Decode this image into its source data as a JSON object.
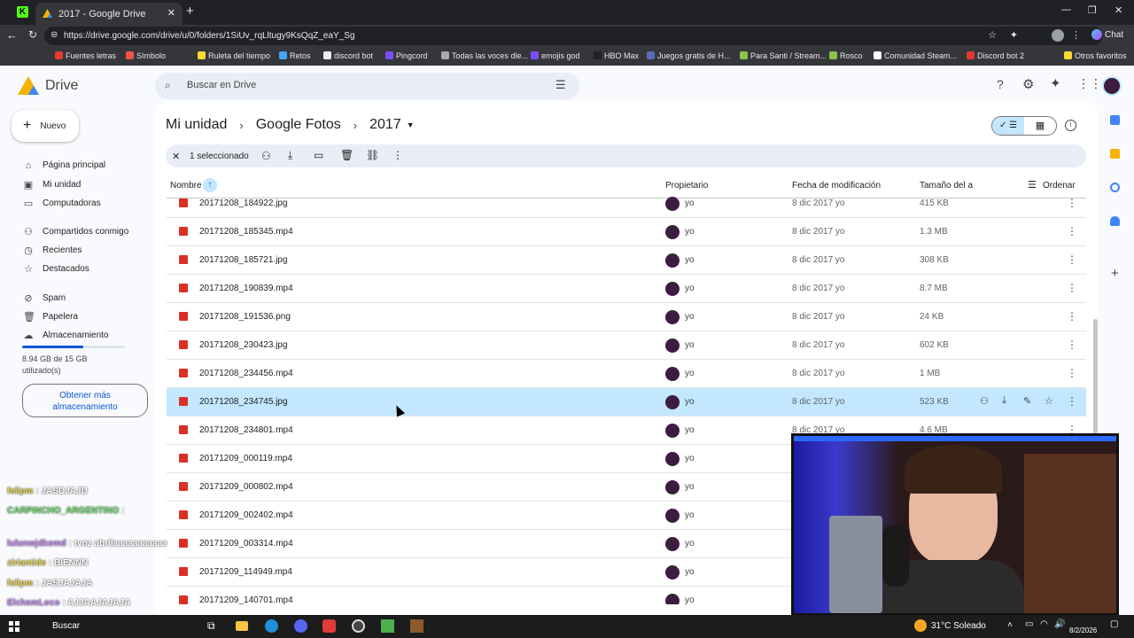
{
  "browser": {
    "tab_title": "2017 - Google Drive",
    "url": "https://drive.google.com/drive/u/0/folders/1SiUv_rqLltugy9KsQqZ_eaY_Sg",
    "chat_label": "Chat",
    "bookmarks": [
      "Fuentes letras",
      "Símbolo",
      "Ruleta del tiempo",
      "Retos",
      "discord bot",
      "Pingcord",
      "Todas las voces dle...",
      "emojis god",
      "HBO Max",
      "Juegos gratis de H...",
      "Para Santi / Stream...",
      "Rosco",
      "Comunidad Steam...",
      "Discord bot 2",
      "Otros favoritos"
    ]
  },
  "drive": {
    "logo_text": "Drive",
    "search_placeholder": "Buscar en Drive",
    "new_button": "Nuevo",
    "sidebar": [
      "Página principal",
      "Mi unidad",
      "Computadoras",
      "Compartidos conmigo",
      "Recientes",
      "Destacados",
      "Spam",
      "Papelera",
      "Almacenamiento"
    ],
    "storage_text": "8.94 GB de 15 GB utilizado(s)",
    "storage_fraction": 0.596,
    "get_more_storage": "Obtener más almacenamiento",
    "breadcrumb": [
      "Mi unidad",
      "Google Fotos",
      "2017"
    ],
    "selection_text": "1 seleccionado",
    "columns": {
      "name": "Nombre",
      "owner": "Propietario",
      "modified": "Fecha de modificación",
      "size": "Tamaño del a",
      "sort": "Ordenar"
    },
    "rows": [
      {
        "name": "20171208_184922.jpg",
        "owner": "yo",
        "date": "8 dic 2017 yo",
        "size": "415 KB"
      },
      {
        "name": "20171208_185345.mp4",
        "owner": "yo",
        "date": "8 dic 2017 yo",
        "size": "1.3 MB"
      },
      {
        "name": "20171208_185721.jpg",
        "owner": "yo",
        "date": "8 dic 2017 yo",
        "size": "308 KB"
      },
      {
        "name": "20171208_190839.mp4",
        "owner": "yo",
        "date": "8 dic 2017 yo",
        "size": "8.7 MB"
      },
      {
        "name": "20171208_191536.png",
        "owner": "yo",
        "date": "8 dic 2017 yo",
        "size": "24 KB"
      },
      {
        "name": "20171208_230423.jpg",
        "owner": "yo",
        "date": "8 dic 2017 yo",
        "size": "602 KB"
      },
      {
        "name": "20171208_234456.mp4",
        "owner": "yo",
        "date": "8 dic 2017 yo",
        "size": "1 MB"
      },
      {
        "name": "20171208_234745.jpg",
        "owner": "yo",
        "date": "8 dic 2017 yo",
        "size": "523 KB"
      },
      {
        "name": "20171208_234801.mp4",
        "owner": "yo",
        "date": "8 dic 2017 yo",
        "size": "4.6 MB"
      },
      {
        "name": "20171209_000119.mp4",
        "owner": "yo",
        "date": "",
        "size": ""
      },
      {
        "name": "20171209_000802.mp4",
        "owner": "yo",
        "date": "",
        "size": ""
      },
      {
        "name": "20171209_002402.mp4",
        "owner": "yo",
        "date": "",
        "size": ""
      },
      {
        "name": "20171209_003314.mp4",
        "owner": "yo",
        "date": "",
        "size": ""
      },
      {
        "name": "20171209_114949.mp4",
        "owner": "yo",
        "date": "",
        "size": ""
      },
      {
        "name": "20171209_140701.mp4",
        "owner": "yo",
        "date": "",
        "size": ""
      }
    ]
  },
  "chat": [
    {
      "user": "felipm",
      "msg": ": JASDJAJD",
      "color": "#e5d34a"
    },
    {
      "user": "CARPINCHO_ARGENTINO",
      "msg": ":",
      "color": "#6ee06e"
    },
    {
      "user": "lulunwjdkemd",
      "msg": ": tvoz abriiaaaaaaaaaaa",
      "color": "#c58bf0"
    },
    {
      "user": "ziriantide",
      "msg": ": BIENNN",
      "color": "#e5d34a"
    },
    {
      "user": "felipm",
      "msg": ": JASJAJAJA",
      "color": "#e5d34a"
    },
    {
      "user": "ElchemLoco",
      "msg": ": AJJAAJAJAJA",
      "color": "#c58bf0"
    }
  ],
  "taskbar": {
    "search": "Buscar",
    "weather": "31°C  Soleado",
    "date": "8/2/2026"
  }
}
